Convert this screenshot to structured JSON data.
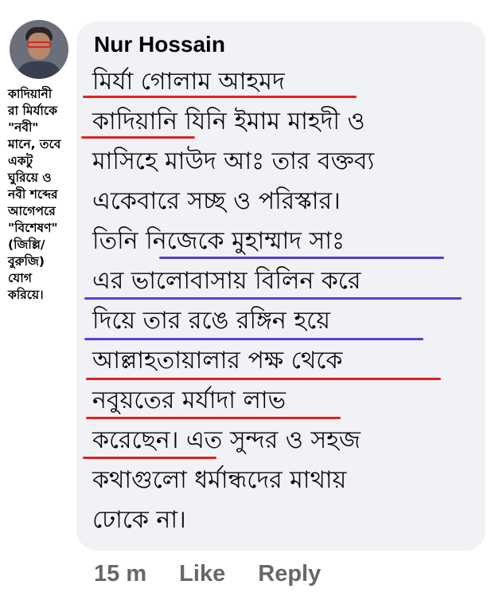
{
  "comment": {
    "author": "Nur Hossain",
    "lines": [
      "মির্যা গোলাম আহমদ",
      "কাদিয়ানি যিনি ইমাম মাহদী ও",
      "মাসিহে মাউদ আঃ তার বক্তব্য",
      "একেবারে সচ্ছ ও পরিস্কার।",
      "তিনি নিজেকে মুহাম্মাদ সাঃ",
      "এর ভালোবাসায় বিলিন করে",
      "দিয়ে তার রঙে রঙ্গিন হয়ে",
      "আল্লাহতায়ালার পক্ষ থেকে",
      "নবুয়তের মর্যাদা লাভ",
      "করেছেন। এত সুন্দর ও সহজ",
      "কথাগুলো ধর্মান্ধদের মাথায়",
      "ঢোকে না।"
    ]
  },
  "side_note": "কাদিয়ানী\nরা মির্যাকে\n\"নবী\"\nমানে, তবে\nএকটু\nঘুরিয়ে ও\nনবী শব্দের\nআগেপরে\n\"বিশেষণ\"\n(জিল্লি/\nবুরুজি)\nযোগ\nকরিয়ে।",
  "actions": {
    "time": "15 m",
    "like": "Like",
    "reply": "Reply"
  },
  "colors": {
    "bubble": "#f0f2f5",
    "underline_red": "#e3211f",
    "underline_blue": "#5a3fd6",
    "action_text": "#65676b"
  }
}
